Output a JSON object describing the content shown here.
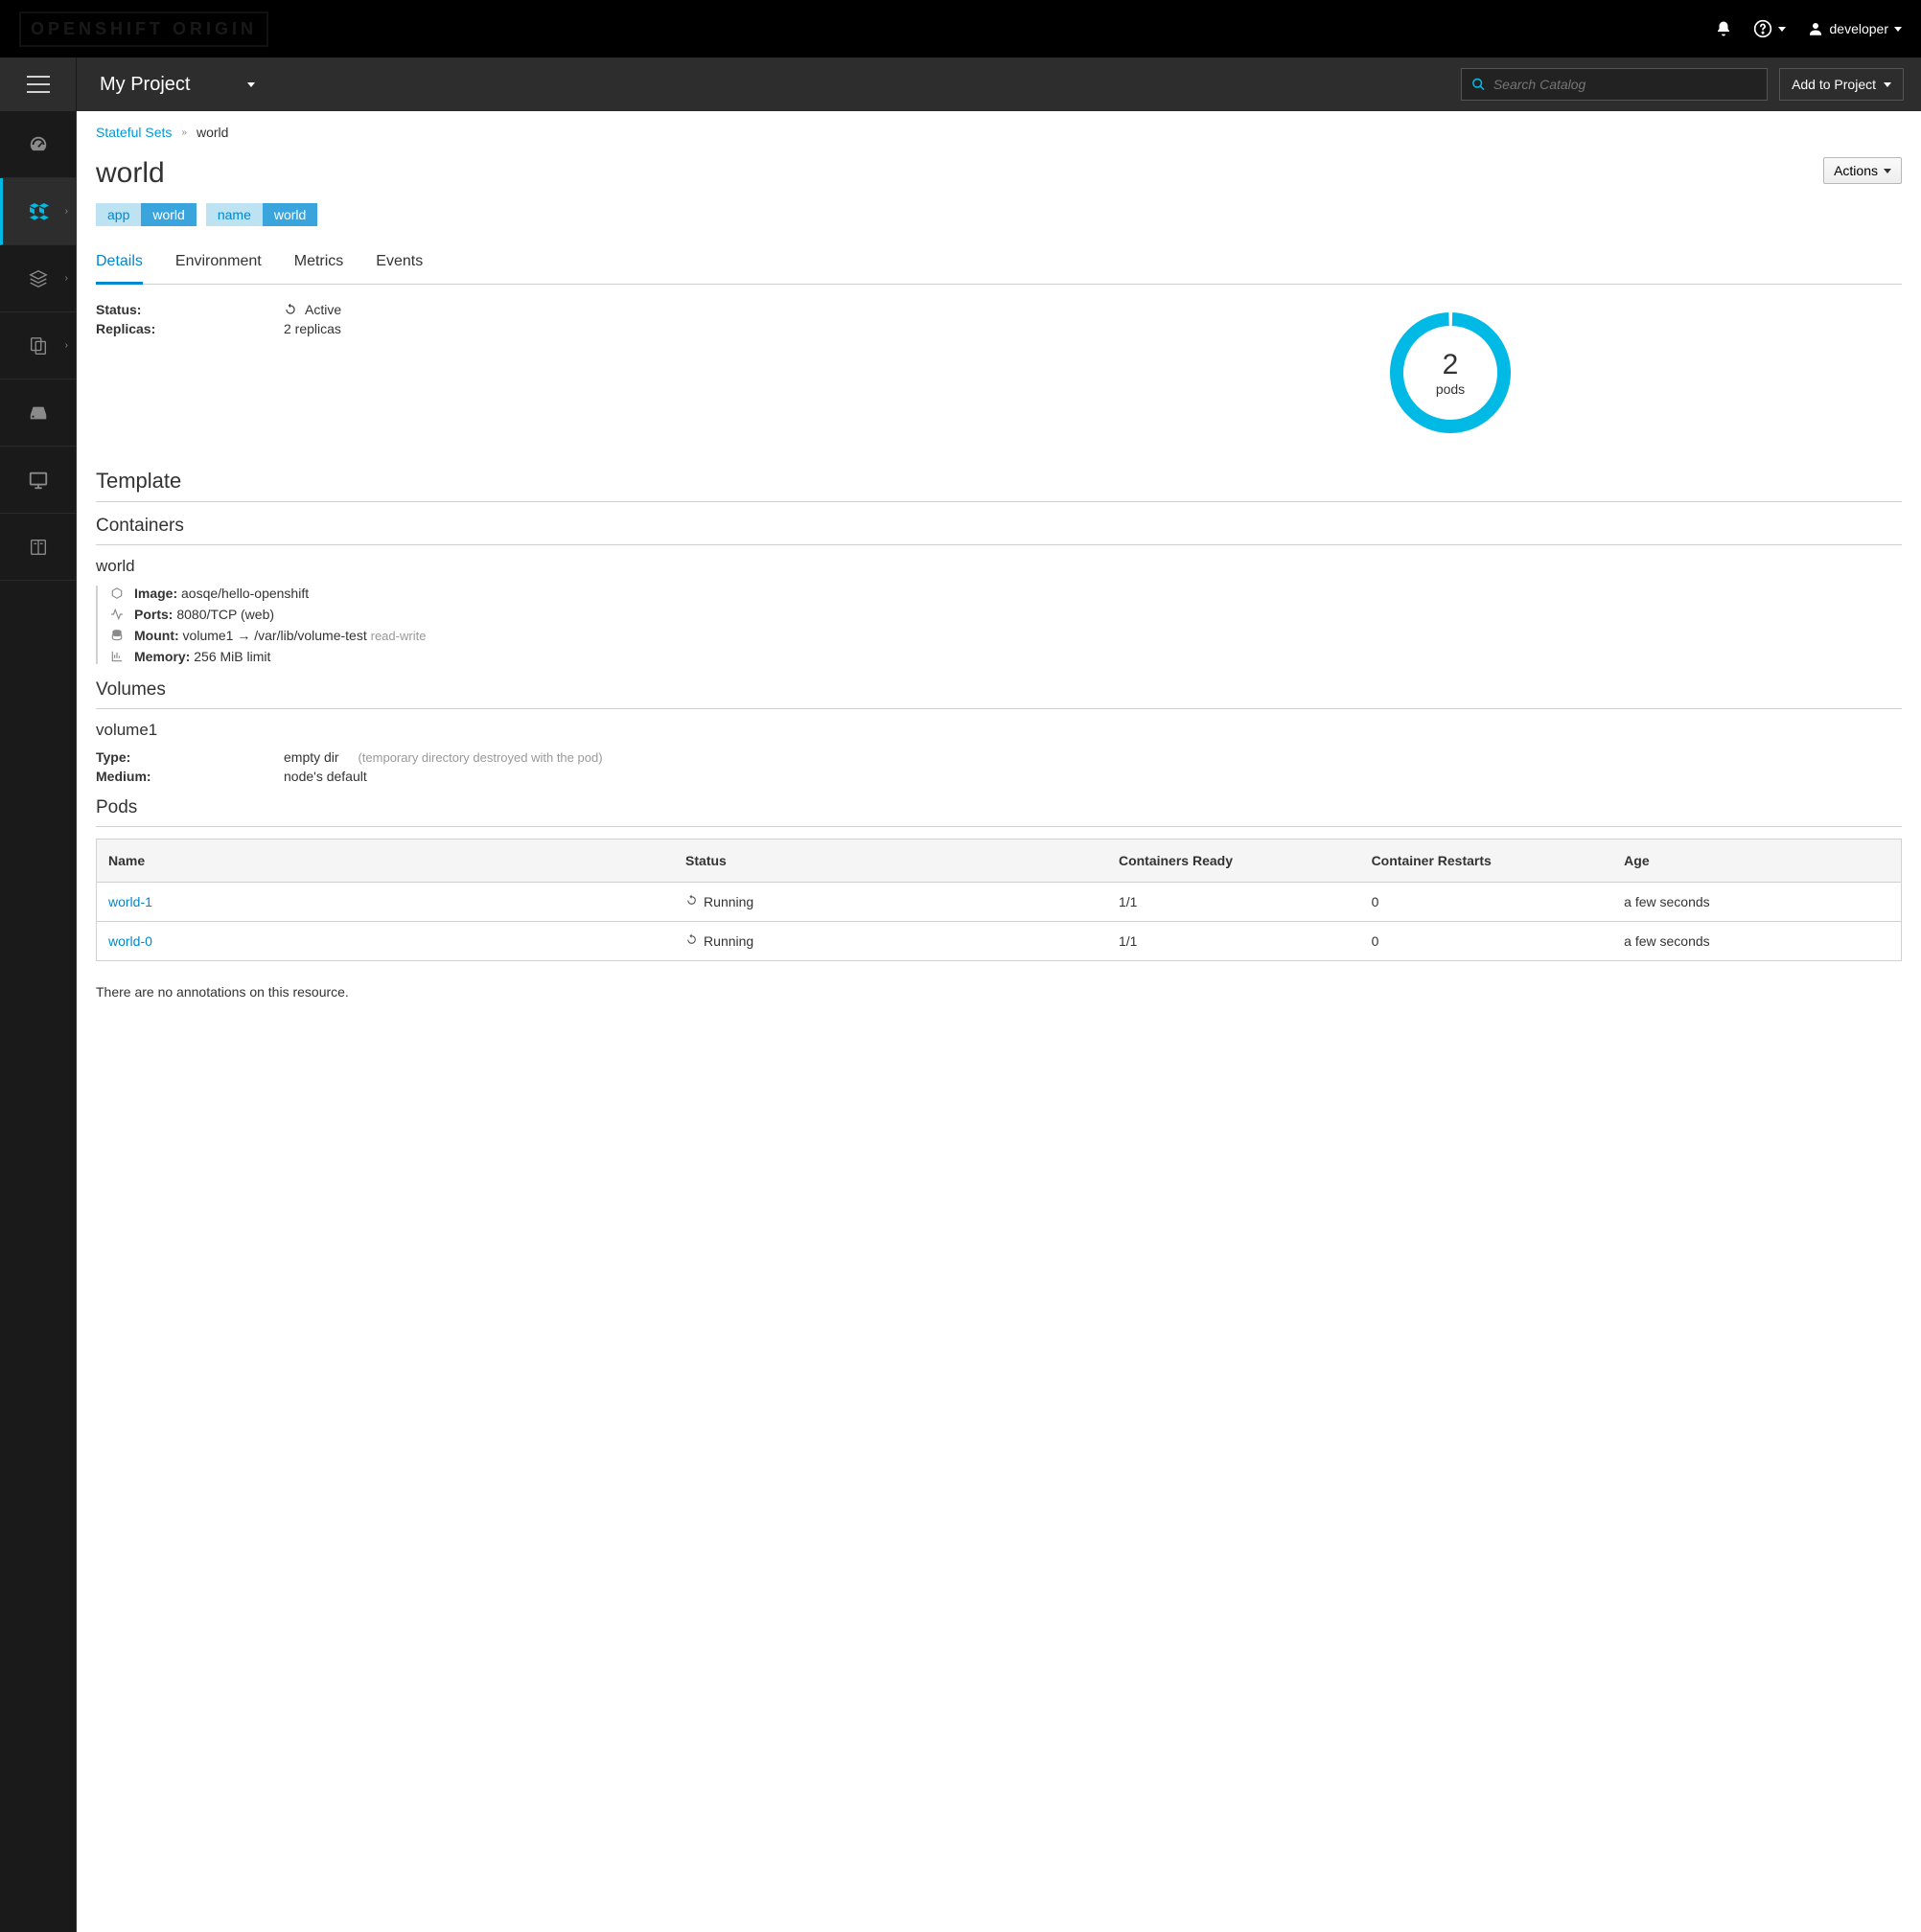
{
  "brand": "OPENSHIFT ORIGIN",
  "masthead": {
    "username": "developer"
  },
  "project_bar": {
    "project_name": "My Project",
    "search_placeholder": "Search Catalog",
    "add_to_project": "Add to Project"
  },
  "breadcrumb": {
    "parent": "Stateful Sets",
    "current": "world"
  },
  "page": {
    "title": "world",
    "actions_label": "Actions"
  },
  "labels": [
    {
      "key": "app",
      "value": "world"
    },
    {
      "key": "name",
      "value": "world"
    }
  ],
  "tabs": [
    {
      "label": "Details",
      "active": true
    },
    {
      "label": "Environment",
      "active": false
    },
    {
      "label": "Metrics",
      "active": false
    },
    {
      "label": "Events",
      "active": false
    }
  ],
  "details": {
    "status_label": "Status:",
    "status_value": "Active",
    "replicas_label": "Replicas:",
    "replicas_value": "2 replicas"
  },
  "donut": {
    "count": "2",
    "label": "pods"
  },
  "sections": {
    "template": "Template",
    "containers": "Containers",
    "volumes": "Volumes",
    "pods": "Pods"
  },
  "container": {
    "name": "world",
    "image_label": "Image:",
    "image_value": "aosqe/hello-openshift",
    "ports_label": "Ports:",
    "ports_value": "8080/TCP (web)",
    "mount_label": "Mount:",
    "mount_value": "volume1 → /var/lib/volume-test",
    "mount_mode": "read-write",
    "memory_label": "Memory:",
    "memory_value": "256 MiB limit"
  },
  "volume": {
    "name": "volume1",
    "type_label": "Type:",
    "type_value": "empty dir",
    "type_note": "(temporary directory destroyed with the pod)",
    "medium_label": "Medium:",
    "medium_value": "node's default"
  },
  "pods_table": {
    "headers": {
      "name": "Name",
      "status": "Status",
      "ready": "Containers Ready",
      "restarts": "Container Restarts",
      "age": "Age"
    },
    "rows": [
      {
        "name": "world-1",
        "status": "Running",
        "ready": "1/1",
        "restarts": "0",
        "age": "a few seconds"
      },
      {
        "name": "world-0",
        "status": "Running",
        "ready": "1/1",
        "restarts": "0",
        "age": "a few seconds"
      }
    ]
  },
  "annotations_msg": "There are no annotations on this resource."
}
